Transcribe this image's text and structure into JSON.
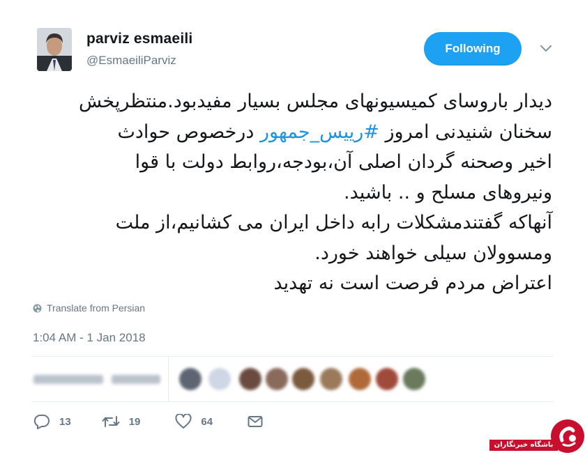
{
  "user": {
    "display_name": "parviz esmaeili",
    "handle": "@EsmaeiliParviz"
  },
  "follow_button": {
    "label": "Following",
    "color": "#1da1f2"
  },
  "tweet": {
    "lines": [
      "دیدار باروسای کمیسیونهای مجلس بسیار مفیدبود.منتظرپخش",
      {
        "before": "سخنان شنیدنی امروز ",
        "hashtag": "#رییس_جمهور",
        "after": " درخصوص حوادث"
      },
      "اخیر وصحنه گردان اصلی آن،بودجه،روابط دولت با قوا",
      "ونیروهای مسلح و .. باشید.",
      "آنهاکه گفتندمشکلات رابه داخل ایران می کشانیم،از ملت",
      "ومسوولان سیلی خواهند خورد.",
      "اعتراض مردم فرصت است نه تهدید"
    ],
    "hashtag_color": "#1b95e0"
  },
  "translate_label": "Translate from Persian",
  "timestamp": "1:04 AM - 1 Jan 2018",
  "actions": {
    "reply_count": "13",
    "retweet_count": "19",
    "like_count": "64"
  },
  "watermark": {
    "text": "باشگاه خبرنگاران",
    "color": "#c8102e"
  }
}
